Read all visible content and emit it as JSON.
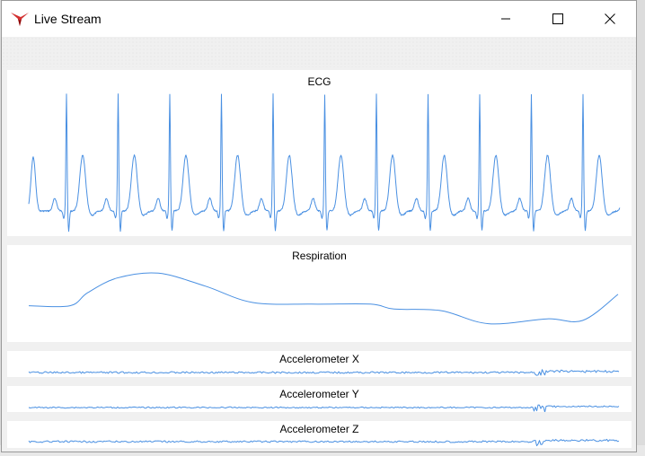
{
  "window": {
    "title": "Live Stream",
    "controls": {
      "minimize": "minimize-icon",
      "maximize": "maximize-icon",
      "close": "close-icon"
    }
  },
  "colors": {
    "trace": "#4a90e2",
    "panel_bg": "#ffffff",
    "window_bg": "#f0f0f0"
  },
  "charts": [
    {
      "id": "ecg",
      "title": "ECG"
    },
    {
      "id": "respiration",
      "title": "Respiration"
    },
    {
      "id": "accel_x",
      "title": "Accelerometer X"
    },
    {
      "id": "accel_y",
      "title": "Accelerometer Y"
    },
    {
      "id": "accel_z",
      "title": "Accelerometer Z"
    }
  ],
  "chart_data": [
    {
      "type": "line",
      "title": "ECG",
      "description_kind": "periodic-ecg-waveform",
      "beat_count": 12,
      "ylim": [
        -1.0,
        1.0
      ],
      "series": [
        {
          "values": []
        }
      ]
    },
    {
      "type": "line",
      "title": "Respiration",
      "x": [
        0,
        0.07,
        0.1,
        0.15,
        0.22,
        0.3,
        0.38,
        0.48,
        0.58,
        0.62,
        0.7,
        0.78,
        0.88,
        0.94,
        1.0
      ],
      "series": [
        {
          "values": [
            0.0,
            0.0,
            0.4,
            0.85,
            1.0,
            0.6,
            0.1,
            0.05,
            0.05,
            -0.1,
            -0.15,
            -0.55,
            -0.4,
            -0.45,
            0.35
          ]
        }
      ],
      "ylim": [
        -1.0,
        1.2
      ]
    },
    {
      "type": "line",
      "title": "Accelerometer X",
      "series": [
        {
          "values": []
        }
      ]
    },
    {
      "type": "line",
      "title": "Accelerometer Y",
      "series": [
        {
          "values": []
        }
      ]
    },
    {
      "type": "line",
      "title": "Accelerometer Z",
      "series": [
        {
          "values": []
        }
      ]
    }
  ]
}
